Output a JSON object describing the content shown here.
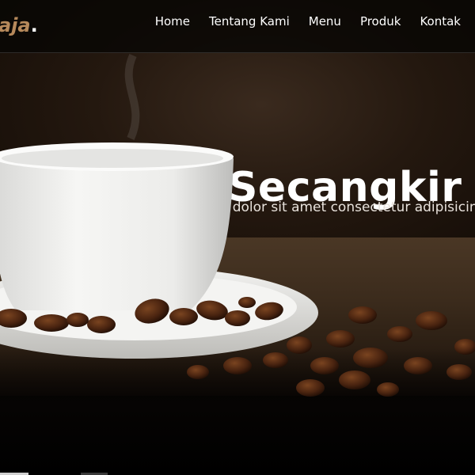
{
  "brand": {
    "logo_text": "aja",
    "logo_dot": "."
  },
  "nav": {
    "items": [
      "Home",
      "Tentang Kami",
      "Menu",
      "Produk",
      "Kontak"
    ]
  },
  "hero": {
    "headline": "Nikmati Secangkir",
    "subtext": "Lorem ipsum dolor sit amet consectetur adipisicing elit. Accusantium"
  },
  "colors": {
    "accent": "#b6895b",
    "nav_text": "#ffffff",
    "headline": "#ffffff"
  }
}
